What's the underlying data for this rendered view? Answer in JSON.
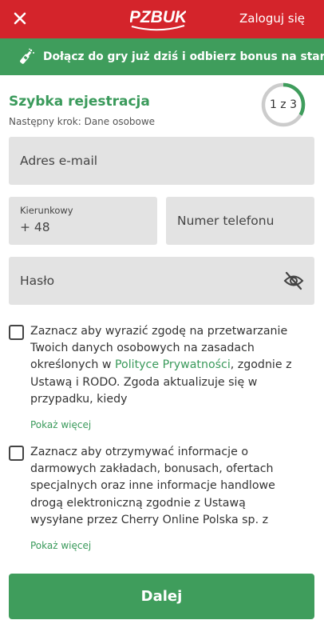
{
  "header": {
    "logo_text": "PZBUK",
    "login_label": "Zaloguj się",
    "close_icon": "close-icon"
  },
  "promo": {
    "icon": "champagne-icon",
    "text": "Dołącz do gry już dziś i odbierz bonus na start!"
  },
  "registration": {
    "title": "Szybka rejestracja",
    "next_step": "Następny krok: Dane osobowe",
    "step_label": "1 z 3",
    "step_current": 1,
    "step_total": 3
  },
  "form": {
    "email_placeholder": "Adres e-mail",
    "prefix_label": "Kierunkowy",
    "prefix_value": "+ 48",
    "phone_placeholder": "Numer telefonu",
    "password_placeholder": "Hasło",
    "password_toggle_icon": "eye-off-icon"
  },
  "consents": [
    {
      "text_before": "Zaznacz aby wyrazić zgodę na przetwarzanie Twoich danych osobowych na zasadach określonych w ",
      "link": "Polityce Prywatności",
      "text_after": ", zgodnie z Ustawą i RODO. Zgoda aktualizuje się w przypadku, kiedy",
      "more": "Pokaż więcej",
      "checked": false
    },
    {
      "text_before": "Zaznacz aby otrzymywać informacje o darmowych zakładach, bonusach, ofertach specjalnych oraz inne informacje handlowe drogą elektroniczną zgodnie z Ustawą wysyłane przez Cherry Online Polska sp. z",
      "link": "",
      "text_after": "",
      "more": "Pokaż więcej",
      "checked": false
    }
  ],
  "submit_label": "Dalej",
  "colors": {
    "brand_red": "#d4242b",
    "brand_green": "#3f9d5c",
    "field_bg": "#e3e3e3"
  }
}
